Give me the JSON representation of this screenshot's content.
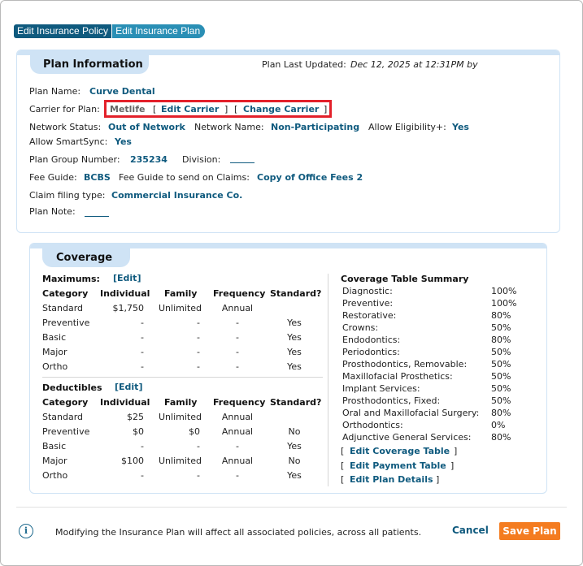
{
  "tabs": {
    "policy": "Edit Insurance Policy",
    "plan": "Edit Insurance Plan"
  },
  "plan_info": {
    "header": "Plan Information",
    "last_updated_label": "Plan Last Updated:",
    "last_updated_value": "Dec 12, 2025 at 12:31PM by",
    "plan_name_label": "Plan Name:",
    "plan_name_value": "Curve Dental",
    "carrier_label": "Carrier for Plan:",
    "carrier_value": "Metlife",
    "edit_carrier": "Edit Carrier",
    "change_carrier": "Change Carrier",
    "bracket_open": "[",
    "bracket_close": "]",
    "network_status_label": "Network Status:",
    "network_status_value": "Out of Network",
    "network_name_label": "Network Name:",
    "network_name_value": "Non-Participating",
    "eligibility_label": "Allow Eligibility+:",
    "eligibility_value": "Yes",
    "smartsync_label": "Allow SmartSync:",
    "smartsync_value": "Yes",
    "group_number_label": "Plan Group Number:",
    "group_number_value": "235234",
    "division_label": "Division:",
    "fee_guide_label": "Fee Guide:",
    "fee_guide_value": "BCBS",
    "fee_guide_claims_label": "Fee Guide to send on Claims:",
    "fee_guide_claims_value": "Copy of Office Fees 2",
    "claim_type_label": "Claim filing type:",
    "claim_type_value": "Commercial Insurance Co.",
    "plan_note_label": "Plan Note:"
  },
  "coverage": {
    "header": "Coverage",
    "edit_label": "[Edit]",
    "columns": [
      "Category",
      "Individual",
      "Family",
      "Frequency",
      "Standard?"
    ],
    "maximums": {
      "title": "Maximums:",
      "rows": [
        [
          "Standard",
          "$1,750",
          "Unlimited",
          "Annual",
          ""
        ],
        [
          "Preventive",
          "-",
          "-",
          "-",
          "Yes"
        ],
        [
          "Basic",
          "-",
          "-",
          "-",
          "Yes"
        ],
        [
          "Major",
          "-",
          "-",
          "-",
          "Yes"
        ],
        [
          "Ortho",
          "-",
          "-",
          "-",
          "Yes"
        ]
      ]
    },
    "deductibles": {
      "title": "Deductibles",
      "rows": [
        [
          "Standard",
          "$25",
          "Unlimited",
          "Annual",
          ""
        ],
        [
          "Preventive",
          "$0",
          "$0",
          "Annual",
          "No"
        ],
        [
          "Basic",
          "-",
          "-",
          "-",
          "Yes"
        ],
        [
          "Major",
          "$100",
          "Unlimited",
          "Annual",
          "No"
        ],
        [
          "Ortho",
          "-",
          "-",
          "-",
          "Yes"
        ]
      ]
    },
    "summary": {
      "title": "Coverage Table Summary",
      "rows": [
        [
          "Diagnostic:",
          "100%"
        ],
        [
          "Preventive:",
          "100%"
        ],
        [
          "Restorative:",
          "80%"
        ],
        [
          "Crowns:",
          "50%"
        ],
        [
          "Endodontics:",
          "80%"
        ],
        [
          "Periodontics:",
          "50%"
        ],
        [
          "Prosthodontics, Removable:",
          "50%"
        ],
        [
          "Maxillofacial Prosthetics:",
          "50%"
        ],
        [
          "Implant Services:",
          "50%"
        ],
        [
          "Prosthodontics, Fixed:",
          "50%"
        ],
        [
          "Oral and Maxillofacial Surgery:",
          "80%"
        ],
        [
          "Orthodontics:",
          "0%"
        ],
        [
          "Adjunctive General Services:",
          "80%"
        ]
      ],
      "links": [
        "Edit Coverage Table",
        "Edit Payment Table",
        "Edit Plan Details"
      ]
    }
  },
  "footer": {
    "info_glyph": "i",
    "message": "Modifying the Insurance Plan will affect all associated policies, across all patients.",
    "cancel": "Cancel",
    "save": "Save Plan"
  }
}
